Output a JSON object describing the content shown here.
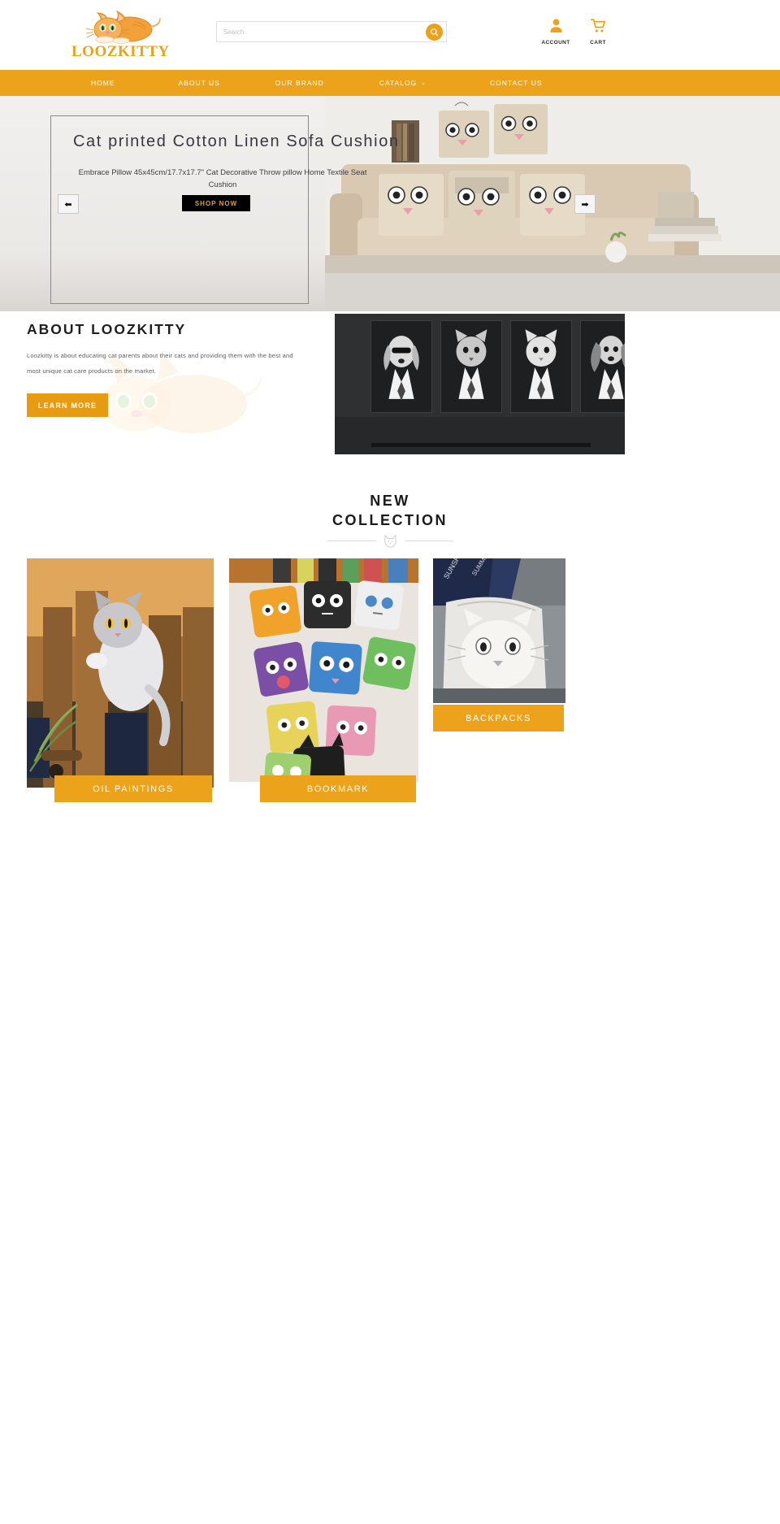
{
  "brand": {
    "logo_text": "LOOZKITTY",
    "logo_icon": "orange-tabby-cat-logo"
  },
  "search": {
    "placeholder": "Search",
    "value": "",
    "icon": "search-icon"
  },
  "header_actions": [
    {
      "label": "ACCOUNT",
      "icon": "user-icon"
    },
    {
      "label": "CART",
      "icon": "shopping-cart-icon"
    }
  ],
  "nav": {
    "items": [
      {
        "label": "HOME",
        "has_dropdown": false
      },
      {
        "label": "ABOUT US",
        "has_dropdown": false
      },
      {
        "label": "OUR BRAND",
        "has_dropdown": false
      },
      {
        "label": "CATALOG",
        "has_dropdown": true,
        "caret": "⌄"
      },
      {
        "label": "CONTACT US",
        "has_dropdown": false
      }
    ],
    "background_color": "#eda21c",
    "text_color": "#ffffff"
  },
  "hero": {
    "title": "Cat  printed  Cotton  Linen  Sofa  Cushion",
    "subtitle": "Embrace Pillow 45x45cm/17.7x17.7\" Cat Decorative Throw pillow Home Textile Seat Cushion",
    "cta_label": "SHOP NOW",
    "cta_bg": "#000000",
    "cta_color": "#d9a04a",
    "prev_arrow": "⬅",
    "next_arrow": "➡",
    "image_alt": "cat-printed-cushions-on-beige-sofa"
  },
  "about": {
    "title": "ABOUT LOOZKITTY",
    "body": "Loozkitty is about educating cat parents about their cats and providing them with the best and most unique cat care products on the market.",
    "cta_label": "LEARN MORE",
    "cta_bg": "#e79b12",
    "image_alt": "four-framed-black-and-white-animal-portraits-in-suits"
  },
  "collection": {
    "title_line1": "NEW",
    "title_line2": "COLLECTION",
    "divider_icon": "cat-head-outline-icon",
    "cards": [
      {
        "label": "OIL PAINTINGS",
        "image_alt": "grey-and-white-cat-oil-painting-on-wooden-door"
      },
      {
        "label": "BOOKMARK",
        "image_alt": "assorted-cartoon-cat-bookmarks-on-desk"
      },
      {
        "label": "BACKPACKS",
        "image_alt": "white-cat-face-backpack-with-navy-print"
      }
    ],
    "label_bg": "#eda21c",
    "label_color": "#ffffff"
  },
  "theme": {
    "accent": "#eda21c",
    "accent_dark": "#e79b12",
    "text_dark": "#1f1f1f",
    "text_muted": "#5f5f5f",
    "page_bg": "#ffffff"
  }
}
